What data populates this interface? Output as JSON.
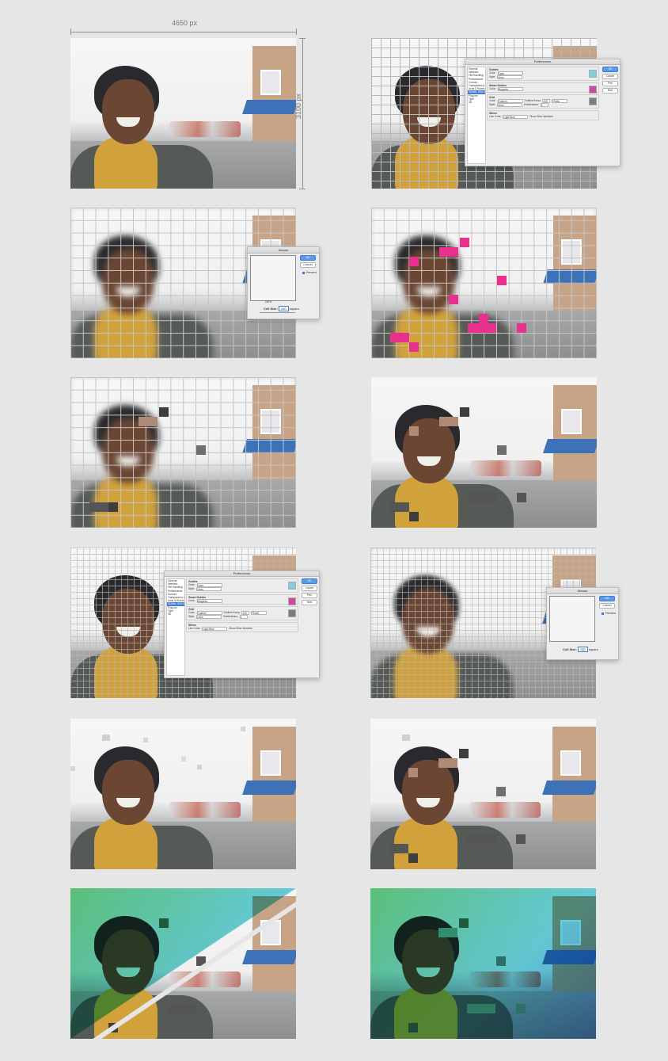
{
  "dimensions": {
    "width_label": "4650 px",
    "height_label": "3100 px"
  },
  "guides_dialog": {
    "title": "Preferences",
    "categories": [
      "General",
      "Interface",
      "File Handling",
      "Performance",
      "Cursors",
      "Transparency & Gamut",
      "Units & Rulers",
      "Guides, Grid & Slices",
      "Plug-Ins",
      "Type",
      "3D"
    ],
    "selected_index": 7,
    "guides": {
      "heading": "Guides",
      "color_label": "Color:",
      "color_value": "Cyan",
      "style_label": "Style:",
      "style_value": "Lines",
      "swatch": "#7fd0dc"
    },
    "smart_guides": {
      "heading": "Smart Guides",
      "color_label": "Color:",
      "color_value": "Magenta",
      "swatch": "#cc4aa0"
    },
    "grid": {
      "heading": "Grid",
      "color_label": "Color:",
      "color_value": "Custom",
      "gridline_label": "Gridline Every:",
      "gridline_value": "100",
      "gridline_unit": "Pixels",
      "style_label": "Style:",
      "style_value": "Lines",
      "subdivisions_label": "Subdivisions:",
      "subdivisions_value": "1",
      "swatch": "#7c7c7c"
    },
    "slices": {
      "heading": "Slices",
      "line_color_label": "Line Color:",
      "line_color_value": "Light Blue",
      "show_numbers_label": "Show Slice Numbers"
    },
    "buttons": {
      "ok": "OK",
      "cancel": "Cancel",
      "prev": "Prev",
      "next": "Next"
    }
  },
  "mosaic_dialog": {
    "title": "Mosaic",
    "ok": "OK",
    "cancel": "Cancel",
    "preview": "Preview",
    "zoom": "100%",
    "cell_size_label": "Cell Size:",
    "cell_size_value_1": "100",
    "cell_size_value_2": "100",
    "cell_size_unit": "square"
  },
  "colors": {
    "background": "#e6e6e6",
    "magenta": "#e8318f",
    "dark_square": "#3e3e3e",
    "grey_square": "#6f6f6f",
    "tan_square": "#b08a74"
  }
}
